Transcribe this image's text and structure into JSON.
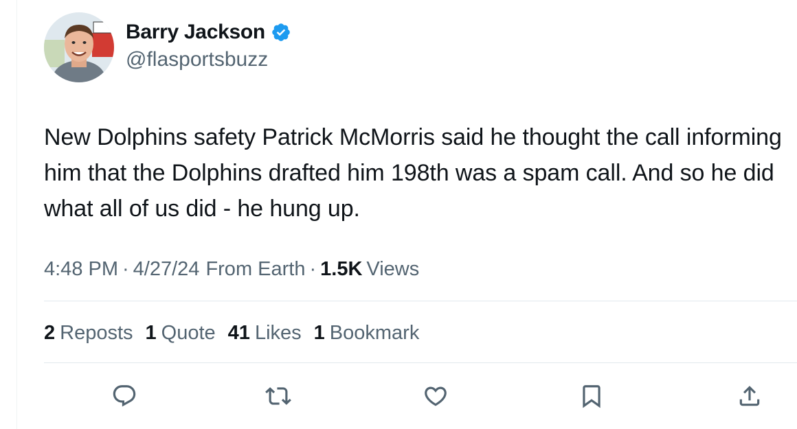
{
  "author": {
    "name": "Barry Jackson",
    "handle": "@flasportsbuzz",
    "verified": true,
    "verified_color": "#1d9bf0"
  },
  "tweet": {
    "text": "New Dolphins safety Patrick McMorris said he thought the call informing him that the Dolphins drafted him 198th was a spam call. And so he did what all of us did - he hung up."
  },
  "meta": {
    "time": "4:48 PM",
    "separator": "·",
    "date": "4/27/24",
    "source": "From Earth",
    "views_count": "1.5K",
    "views_label": "Views"
  },
  "stats": {
    "reposts_count": "2",
    "reposts_label": "Reposts",
    "quotes_count": "1",
    "quotes_label": "Quote",
    "likes_count": "41",
    "likes_label": "Likes",
    "bookmarks_count": "1",
    "bookmarks_label": "Bookmark"
  },
  "actions": {
    "icons": [
      "reply-icon",
      "repost-icon",
      "like-icon",
      "bookmark-icon",
      "share-icon"
    ],
    "icon_color": "#536471"
  }
}
